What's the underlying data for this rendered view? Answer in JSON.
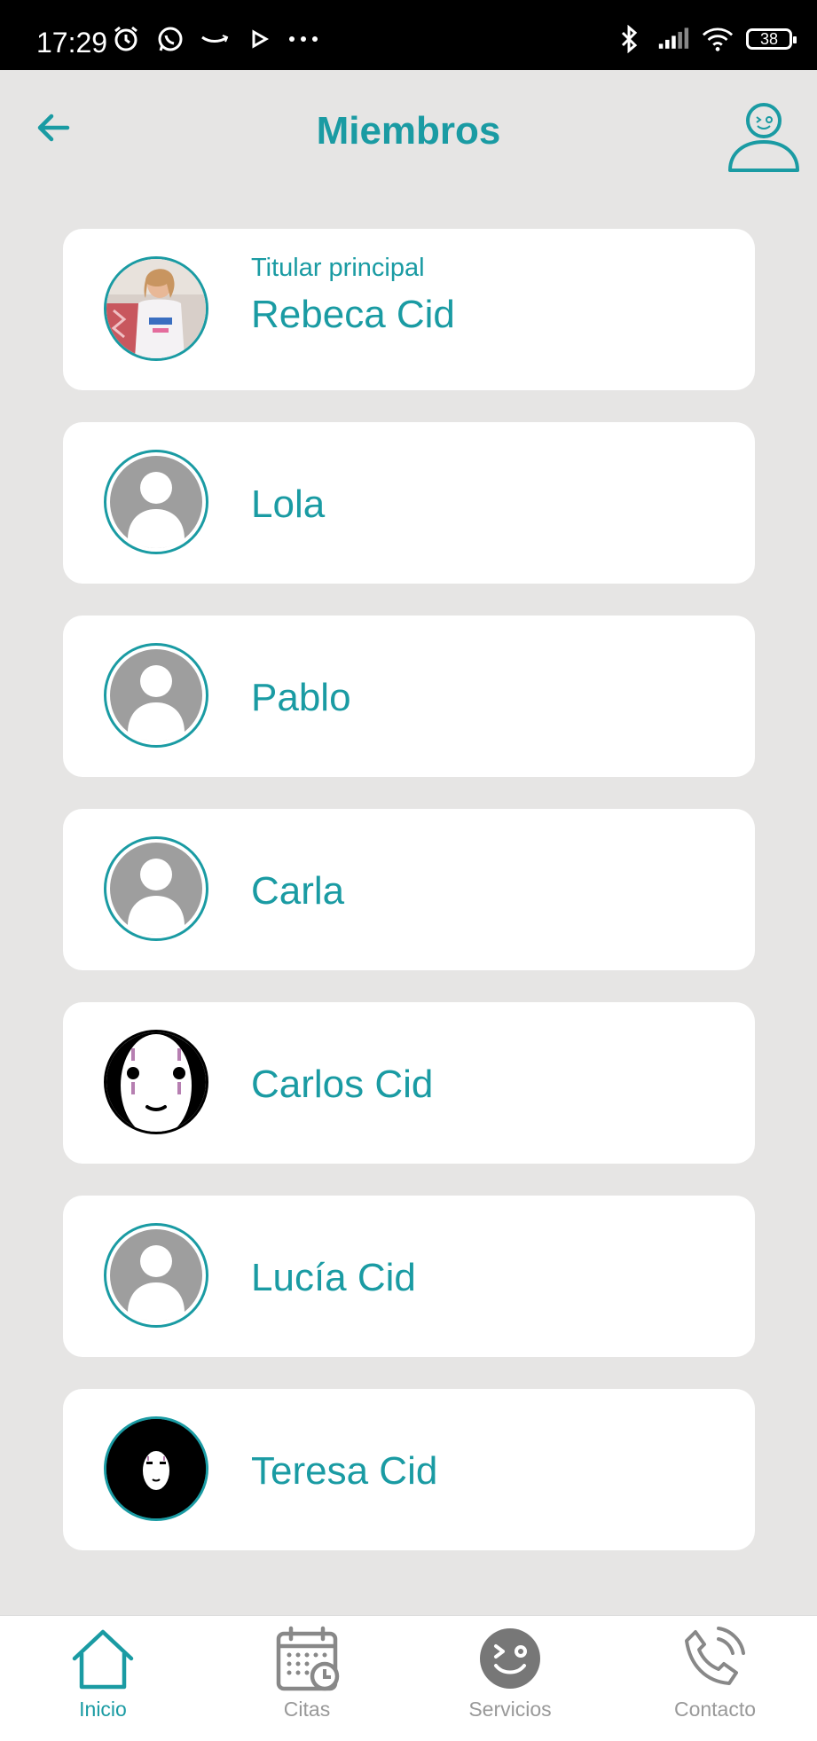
{
  "status_bar": {
    "time": "17:29",
    "battery": "38",
    "left_icons": [
      "alarm-icon",
      "whatsapp-icon",
      "amazon-icon",
      "play-icon",
      "more-icon"
    ],
    "right_icons": [
      "bluetooth-icon",
      "signal-icon",
      "wifi-icon",
      "battery-icon"
    ]
  },
  "header": {
    "title": "Miembros",
    "back_icon": "arrow-left-icon",
    "profile_icon": "user-profile-icon"
  },
  "colors": {
    "accent": "#1a9ba3",
    "background": "#e6e5e4",
    "card": "#ffffff",
    "inactive": "#999999",
    "placeholder_avatar": "#9e9e9e"
  },
  "members": [
    {
      "subtitle": "Titular principal",
      "name": "Rebeca Cid",
      "avatar": "photo"
    },
    {
      "name": "Lola",
      "avatar": "default"
    },
    {
      "name": "Pablo",
      "avatar": "default"
    },
    {
      "name": "Carla",
      "avatar": "default"
    },
    {
      "name": "Carlos Cid",
      "avatar": "mask-white"
    },
    {
      "name": "Lucía Cid",
      "avatar": "default"
    },
    {
      "name": "Teresa Cid",
      "avatar": "mask-black"
    }
  ],
  "bottom_nav": {
    "items": [
      {
        "label": "Inicio",
        "icon": "home-icon",
        "active": true
      },
      {
        "label": "Citas",
        "icon": "calendar-icon",
        "active": false
      },
      {
        "label": "Servicios",
        "icon": "smiley-icon",
        "active": false
      },
      {
        "label": "Contacto",
        "icon": "phone-icon",
        "active": false
      }
    ]
  }
}
